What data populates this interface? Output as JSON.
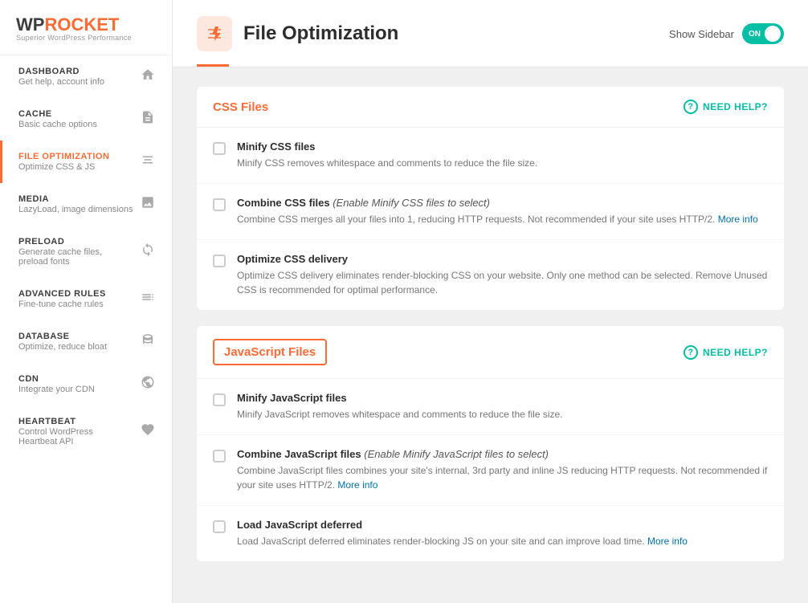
{
  "logo": {
    "wp": "WP",
    "rocket": "ROCKET",
    "sub": "Superior WordPress Performance"
  },
  "sidebar": {
    "items": [
      {
        "id": "dashboard",
        "title": "DASHBOARD",
        "sub": "Get help, account info",
        "icon": "⌂",
        "active": false
      },
      {
        "id": "cache",
        "title": "CACHE",
        "sub": "Basic cache options",
        "icon": "📄",
        "active": false
      },
      {
        "id": "file-optimization",
        "title": "FILE OPTIMIZATION",
        "sub": "Optimize CSS & JS",
        "icon": "⚡",
        "active": true
      },
      {
        "id": "media",
        "title": "MEDIA",
        "sub": "LazyLoad, image dimensions",
        "icon": "🖼",
        "active": false
      },
      {
        "id": "preload",
        "title": "PRELOAD",
        "sub": "Generate cache files, preload fonts",
        "icon": "↻",
        "active": false
      },
      {
        "id": "advanced-rules",
        "title": "ADVANCED RULES",
        "sub": "Fine-tune cache rules",
        "icon": "☰",
        "active": false
      },
      {
        "id": "database",
        "title": "DATABASE",
        "sub": "Optimize, reduce bloat",
        "icon": "🗄",
        "active": false
      },
      {
        "id": "cdn",
        "title": "CDN",
        "sub": "Integrate your CDN",
        "icon": "🌐",
        "active": false
      },
      {
        "id": "heartbeat",
        "title": "HEARTBEAT",
        "sub": "Control WordPress Heartbeat API",
        "icon": "♥",
        "active": false
      }
    ]
  },
  "header": {
    "icon": "⚡",
    "title": "File Optimization",
    "sidebar_toggle_label": "Show Sidebar",
    "toggle_state": "ON"
  },
  "css_section": {
    "title": "CSS Files",
    "need_help": "NEED HELP?",
    "options": [
      {
        "id": "minify-css",
        "title": "Minify CSS files",
        "title_suffix": "",
        "desc": "Minify CSS removes whitespace and comments to reduce the file size.",
        "checked": false
      },
      {
        "id": "combine-css",
        "title": "Combine CSS files",
        "title_italic": "(Enable Minify CSS files to select)",
        "desc": "Combine CSS merges all your files into 1, reducing HTTP requests. Not recommended if your site uses HTTP/2.",
        "more_link": "More info",
        "checked": false
      },
      {
        "id": "optimize-css-delivery",
        "title": "Optimize CSS delivery",
        "title_italic": "",
        "desc": "Optimize CSS delivery eliminates render-blocking CSS on your website. Only one method can be selected. Remove Unused CSS is recommended for optimal performance.",
        "checked": false
      }
    ]
  },
  "js_section": {
    "title": "JavaScript Files",
    "need_help": "NEED HELP?",
    "highlighted": true,
    "options": [
      {
        "id": "minify-js",
        "title": "Minify JavaScript files",
        "title_italic": "",
        "desc": "Minify JavaScript removes whitespace and comments to reduce the file size.",
        "checked": false
      },
      {
        "id": "combine-js",
        "title": "Combine JavaScript files",
        "title_italic": "(Enable Minify JavaScript files to select)",
        "desc": "Combine JavaScript files combines your site's internal, 3rd party and inline JS reducing HTTP requests. Not recommended if your site uses HTTP/2.",
        "more_link": "More info",
        "checked": false
      },
      {
        "id": "load-js-deferred",
        "title": "Load JavaScript deferred",
        "title_italic": "",
        "desc": "Load JavaScript deferred eliminates render-blocking JS on your site and can improve load time.",
        "more_link": "More info",
        "checked": false
      }
    ]
  }
}
